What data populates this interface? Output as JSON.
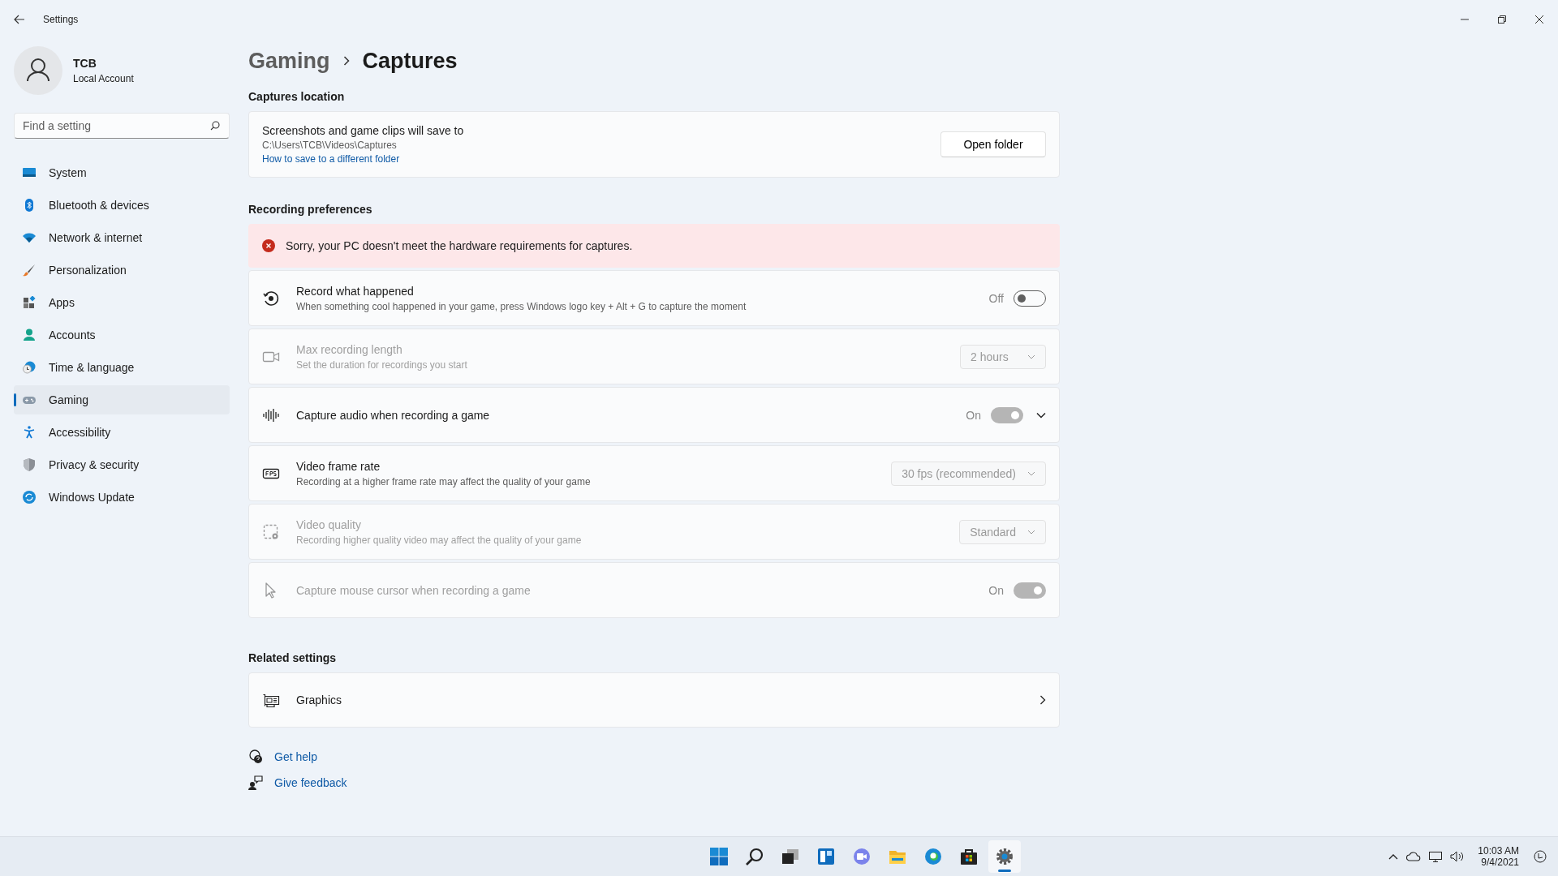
{
  "window": {
    "title": "Settings"
  },
  "user": {
    "name": "TCB",
    "account": "Local Account"
  },
  "search": {
    "placeholder": "Find a setting"
  },
  "nav": [
    {
      "label": "System",
      "selected": false
    },
    {
      "label": "Bluetooth & devices",
      "selected": false
    },
    {
      "label": "Network & internet",
      "selected": false
    },
    {
      "label": "Personalization",
      "selected": false
    },
    {
      "label": "Apps",
      "selected": false
    },
    {
      "label": "Accounts",
      "selected": false
    },
    {
      "label": "Time & language",
      "selected": false
    },
    {
      "label": "Gaming",
      "selected": true
    },
    {
      "label": "Accessibility",
      "selected": false
    },
    {
      "label": "Privacy & security",
      "selected": false
    },
    {
      "label": "Windows Update",
      "selected": false
    }
  ],
  "breadcrumb": [
    "Gaming",
    "Captures"
  ],
  "captures_location": {
    "heading": "Captures location",
    "title": "Screenshots and game clips will save to",
    "path": "C:\\Users\\TCB\\Videos\\Captures",
    "link": "How to save to a different folder",
    "button": "Open folder"
  },
  "recording": {
    "heading": "Recording preferences",
    "error": "Sorry, your PC doesn't meet the hardware requirements for captures.",
    "rows": [
      {
        "title": "Record what happened",
        "description": "When something cool happened in your game, press Windows logo key + Alt + G to capture the moment",
        "disabled": false,
        "control": {
          "kind": "toggle",
          "label": "Off",
          "on": false,
          "disabled": false
        }
      },
      {
        "title": "Max recording length",
        "description": "Set the duration for recordings you start",
        "disabled": true,
        "control": {
          "kind": "dropdown",
          "value": "2 hours",
          "disabled": true
        }
      },
      {
        "title": "Capture audio when recording a game",
        "disabled": false,
        "expanded": false,
        "control": {
          "kind": "toggle",
          "label": "On",
          "on": true,
          "disabled": true
        }
      },
      {
        "title": "Video frame rate",
        "description": "Recording at a higher frame rate may affect the quality of your game",
        "disabled": false,
        "control": {
          "kind": "dropdown",
          "value": "30 fps (recommended)",
          "disabled": true
        }
      },
      {
        "title": "Video quality",
        "description": "Recording higher quality video may affect the quality of your game",
        "disabled": true,
        "control": {
          "kind": "dropdown",
          "value": "Standard",
          "disabled": true
        }
      },
      {
        "title": "Capture mouse cursor when recording a game",
        "disabled": true,
        "control": {
          "kind": "toggle",
          "label": "On",
          "on": true,
          "disabled": true
        }
      }
    ]
  },
  "related": {
    "heading": "Related settings",
    "items": [
      {
        "label": "Graphics"
      }
    ]
  },
  "help_links": [
    "Get help",
    "Give feedback"
  ],
  "taskbar": {
    "apps": [
      {
        "selected": false
      },
      {
        "selected": false
      },
      {
        "selected": false
      },
      {
        "selected": false
      },
      {
        "selected": false
      },
      {
        "selected": false
      },
      {
        "selected": false
      },
      {
        "selected": false
      },
      {
        "selected": true
      }
    ],
    "time": "10:03 AM",
    "date": "9/4/2021"
  }
}
